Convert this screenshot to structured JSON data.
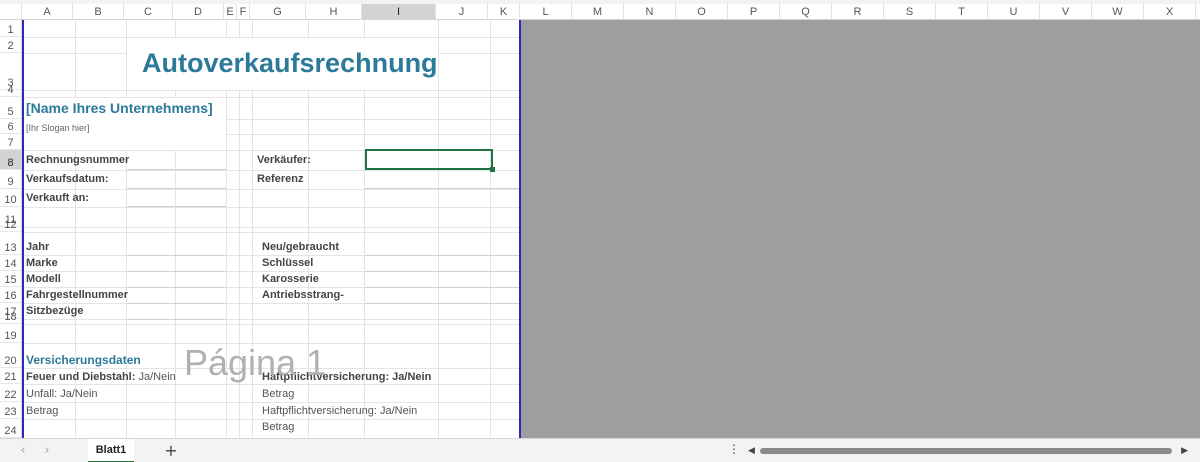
{
  "columns": [
    "A",
    "B",
    "C",
    "D",
    "E",
    "F",
    "G",
    "H",
    "I",
    "J",
    "K",
    "L",
    "M",
    "N",
    "O",
    "P",
    "Q",
    "R",
    "S",
    "T",
    "U",
    "V",
    "W",
    "X"
  ],
  "rows": [
    "1",
    "2",
    "3",
    "4",
    "5",
    "6",
    "7",
    "8",
    "9",
    "10",
    "11",
    "12",
    "13",
    "14",
    "15",
    "16",
    "17",
    "18",
    "19",
    "20",
    "21",
    "22",
    "23",
    "24"
  ],
  "selected_column": "I",
  "selected_row": "8",
  "invoice": {
    "title": "Autoverkaufsrechnung",
    "company": "[Name Ihres Unternehmens]",
    "slogan": "[Ihr Slogan hier]",
    "invoice_number_label": "Rechnungsnummer",
    "sale_date_label": "Verkaufsdatum:",
    "sold_to_label": "Verkauft an:",
    "seller_label": "Verkäufer:",
    "reference_label": "Referenz",
    "year_label": "Jahr",
    "brand_label": "Marke",
    "model_label": "Modell",
    "vin_label": "Fahrgestellnummer",
    "seat_covers_label": "Sitzbezüge",
    "new_used_label": "Neu/gebraucht",
    "keys_label": "Schlüssel",
    "body_label": "Karosserie",
    "drivetrain_label": "Antriebsstrang-",
    "insurance_header": "Versicherungsdaten",
    "fire_theft_label": "Feuer und Diebstahl:",
    "fire_theft_value": "Ja/Nein",
    "accident_label": "Unfall: Ja/Nein",
    "amount_left": "Betrag",
    "liability_label": "Haftpflichtversicherung: Ja/Nein",
    "liability_amount": "Betrag",
    "liability_label_2": "Haftpflichtversicherung: Ja/Nein",
    "liability_amount_2": "Betrag"
  },
  "watermark": "Página 1",
  "sheet_tab": "Blatt1",
  "add_sheet_symbol": "+",
  "accent_color": "#217346",
  "title_color": "#2b7a9a",
  "page_border_color": "#2b2bb8"
}
